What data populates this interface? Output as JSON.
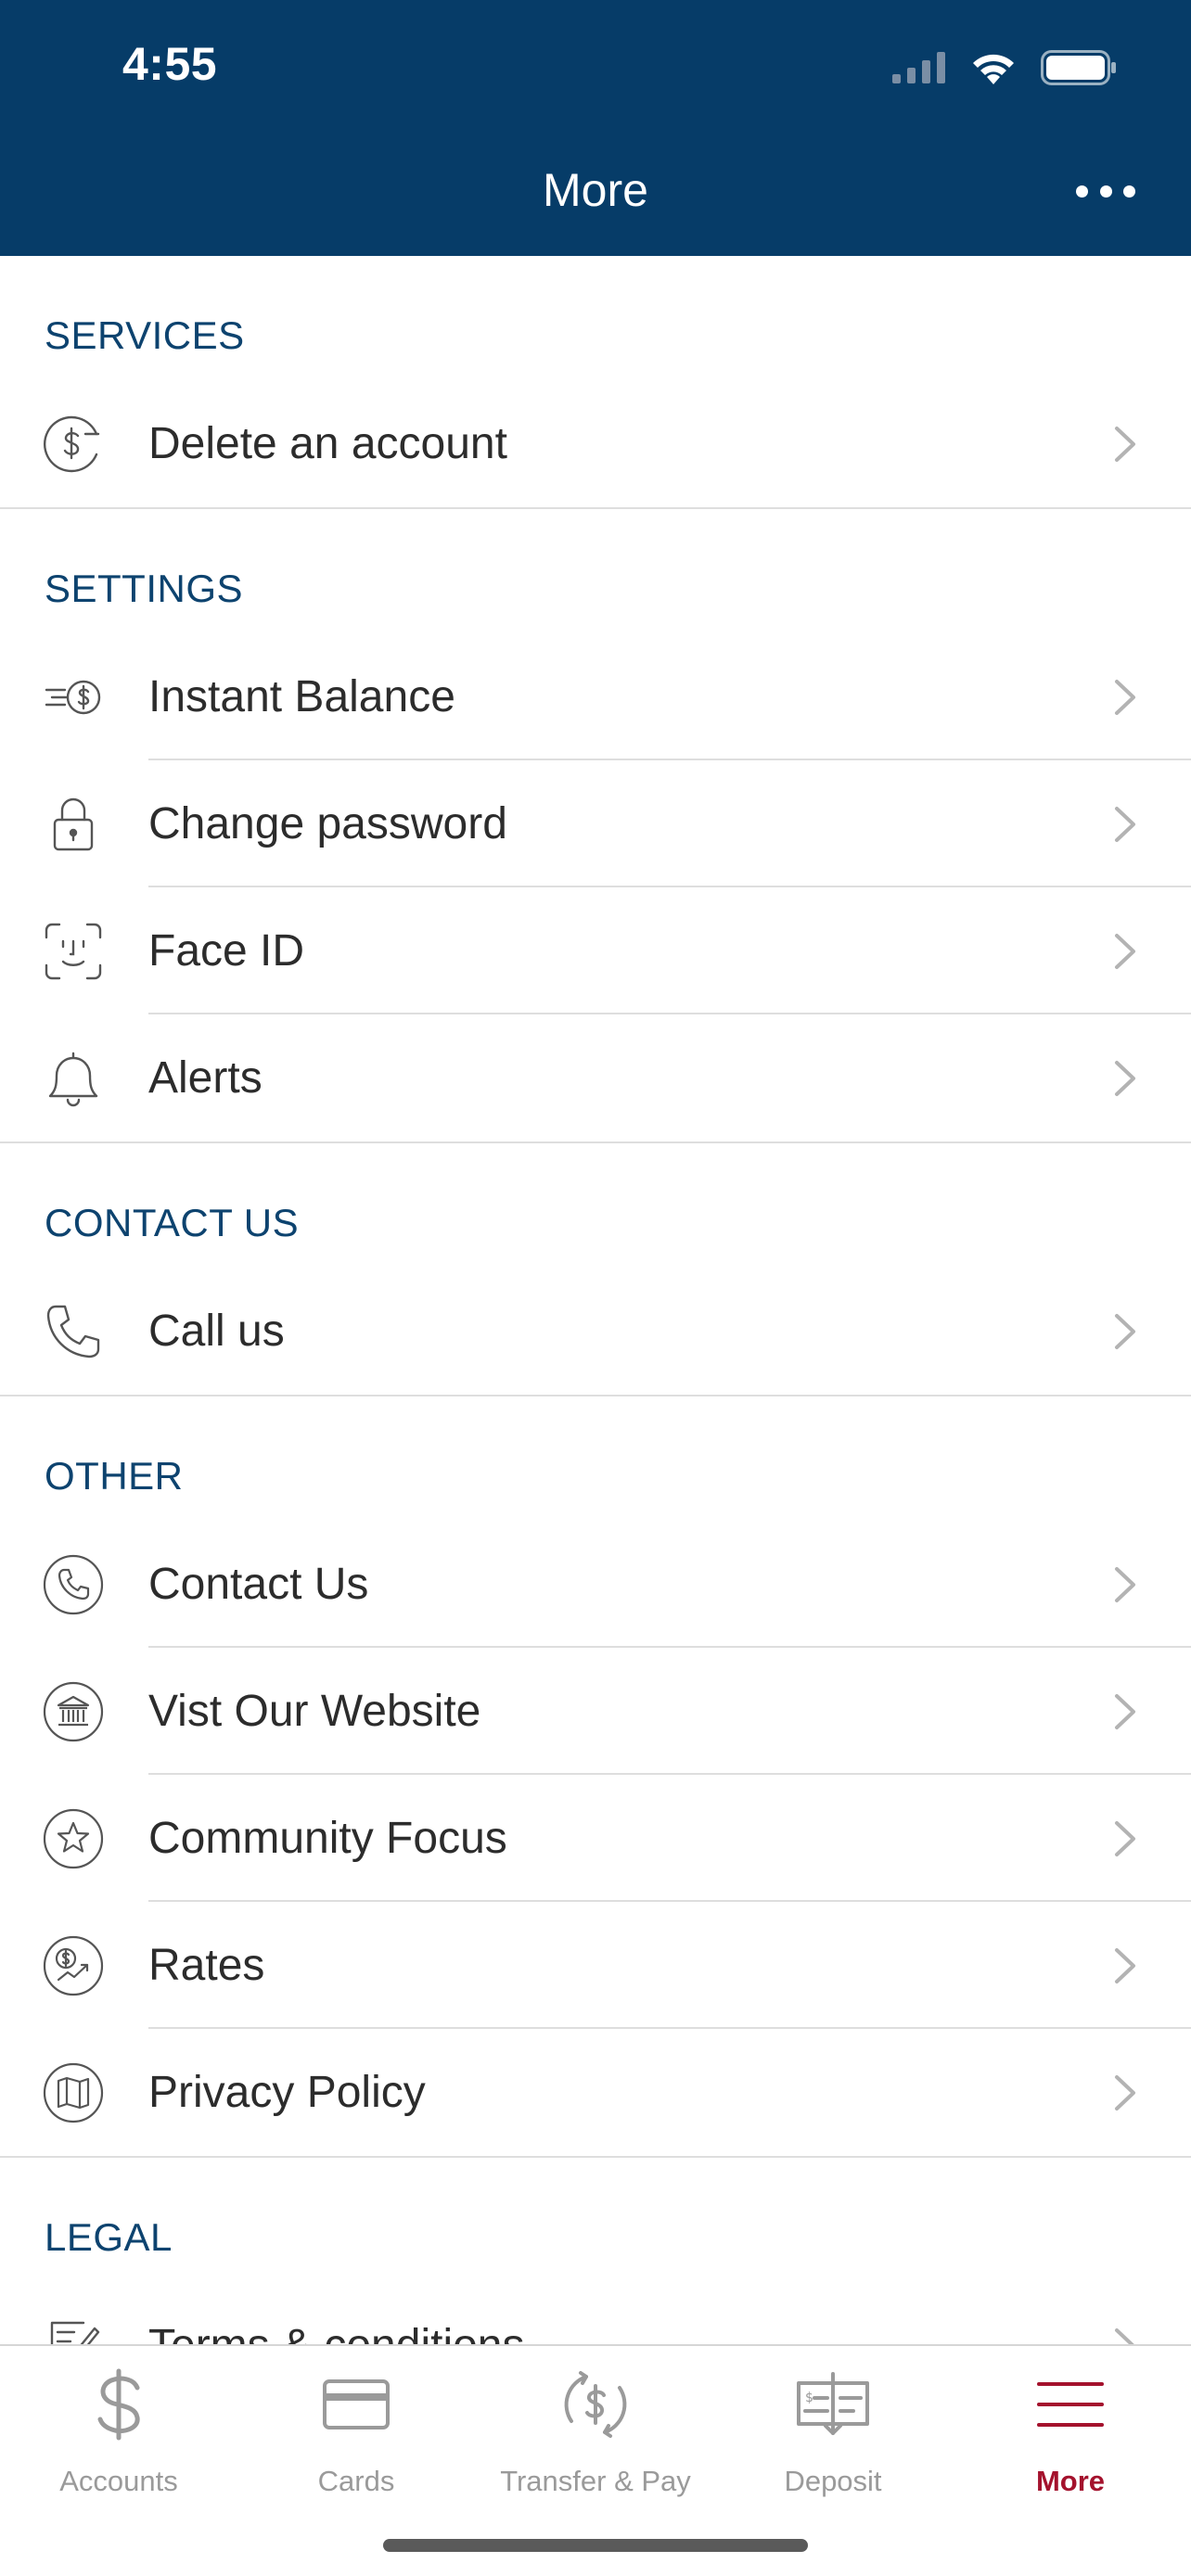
{
  "status_bar": {
    "time": "4:55"
  },
  "header": {
    "title": "More"
  },
  "sections": [
    {
      "title": "SERVICES",
      "items": [
        {
          "label": "Delete an account",
          "icon": "dollar-minus-circle-icon"
        }
      ]
    },
    {
      "title": "SETTINGS",
      "items": [
        {
          "label": "Instant Balance",
          "icon": "fast-dollar-icon"
        },
        {
          "label": "Change password",
          "icon": "lock-icon"
        },
        {
          "label": "Face ID",
          "icon": "face-id-icon"
        },
        {
          "label": "Alerts",
          "icon": "bell-icon"
        }
      ]
    },
    {
      "title": "CONTACT US",
      "items": [
        {
          "label": "Call us",
          "icon": "phone-icon"
        }
      ]
    },
    {
      "title": "OTHER",
      "items": [
        {
          "label": "Contact Us",
          "icon": "phone-circle-icon"
        },
        {
          "label": "Vist Our Website",
          "icon": "bank-circle-icon"
        },
        {
          "label": "Community Focus",
          "icon": "star-circle-icon"
        },
        {
          "label": "Rates",
          "icon": "rates-circle-icon"
        },
        {
          "label": "Privacy Policy",
          "icon": "map-circle-icon"
        }
      ]
    },
    {
      "title": "LEGAL",
      "items": [
        {
          "label": "Terms & conditions",
          "icon": "document-pen-icon"
        }
      ]
    }
  ],
  "tabbar": {
    "tabs": [
      {
        "label": "Accounts",
        "icon": "dollar-icon"
      },
      {
        "label": "Cards",
        "icon": "card-icon"
      },
      {
        "label": "Transfer & Pay",
        "icon": "transfer-icon"
      },
      {
        "label": "Deposit",
        "icon": "check-deposit-icon"
      },
      {
        "label": "More",
        "icon": "menu-icon"
      }
    ],
    "active": "More"
  },
  "colors": {
    "header_bg": "#063c68",
    "section_title": "#0d436f",
    "active_tab": "#a4122d",
    "inactive_tab": "#9a9a9a"
  }
}
